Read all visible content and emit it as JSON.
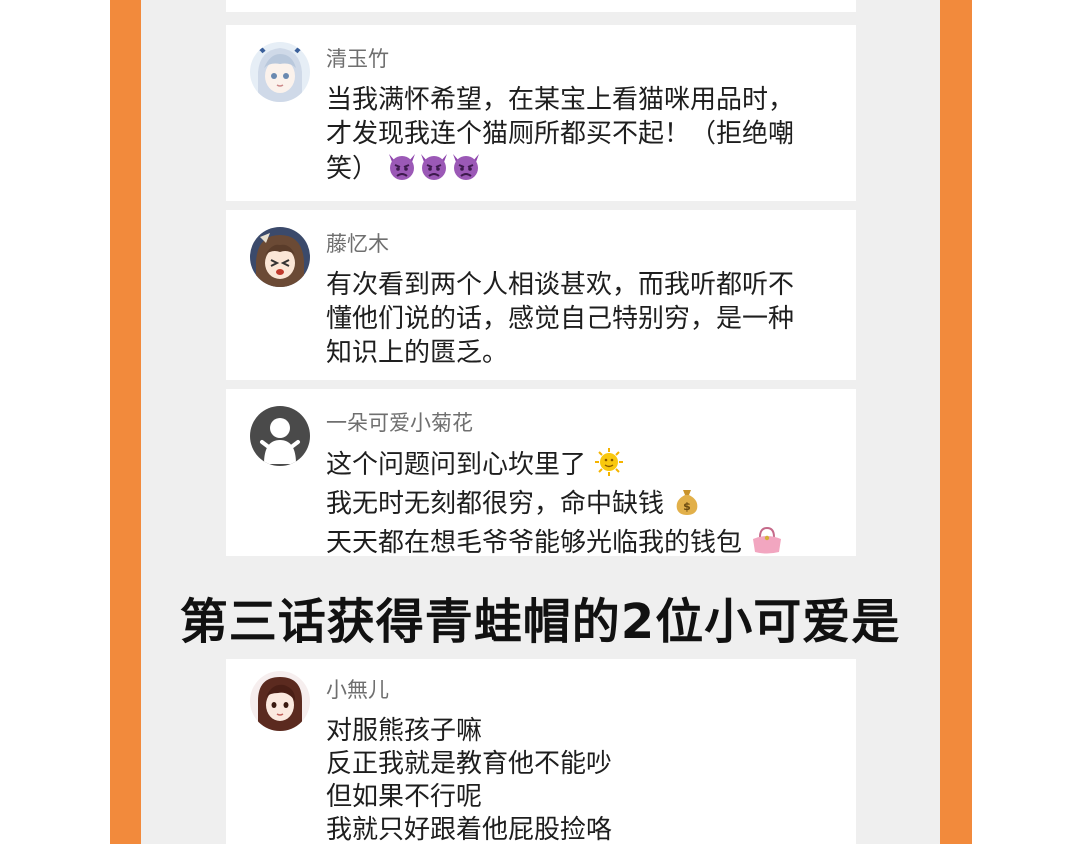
{
  "comments": [
    {
      "username": "清玉竹",
      "lines": [
        "当我满怀希望，在某宝上看猫咪用品时，",
        "才发现我连个猫厕所都买不起！（拒绝嘲",
        "笑）"
      ],
      "trailing_emojis": [
        "angry-devil-icon",
        "angry-devil-icon",
        "angry-devil-icon"
      ]
    },
    {
      "username": "藤忆木",
      "lines": [
        "有次看到两个人相谈甚欢，而我听都听不",
        "懂他们说的话，感觉自己特别穷，是一种",
        "知识上的匮乏。"
      ]
    },
    {
      "username": "一朵可爱小菊花",
      "lines": [
        "这个问题问到心坎里了",
        "我无时无刻都很穷，命中缺钱",
        "天天都在想毛爷爷能够光临我的钱包"
      ],
      "line_emojis": [
        "sun-face-icon",
        "money-bag-icon",
        "purse-icon"
      ]
    }
  ],
  "headline": "第三话获得青蛙帽的2位小可爱是",
  "winner": {
    "username": "小無儿",
    "lines": [
      "对服熊孩子嘛",
      "反正我就是教育他不能吵",
      "但如果不行呢",
      "我就只好跟着他屁股捡咯"
    ]
  },
  "colors": {
    "frame": "#f28a3c",
    "panel": "#efefef",
    "card": "#ffffff",
    "username": "#6f6f6f",
    "text": "#1e1e1e"
  }
}
